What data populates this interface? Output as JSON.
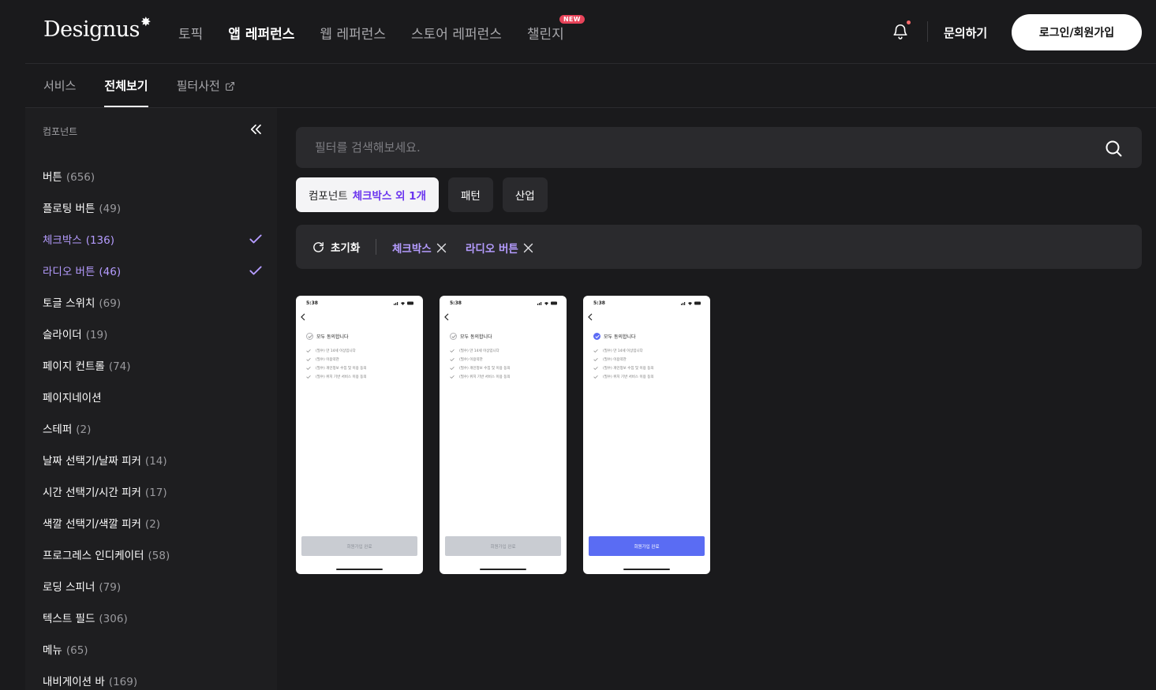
{
  "header": {
    "logo": "Designus",
    "nav": [
      {
        "label": "토픽",
        "active": false
      },
      {
        "label": "앱 레퍼런스",
        "active": true
      },
      {
        "label": "웹 레퍼런스",
        "active": false
      },
      {
        "label": "스토어 레퍼런스",
        "active": false
      },
      {
        "label": "챌린지",
        "active": false,
        "badge": "NEW"
      }
    ],
    "inquiry": "문의하기",
    "login": "로그인/회원가입",
    "notification_dot_color": "#ff6b6b"
  },
  "subtabs": [
    {
      "label": "서비스",
      "active": false
    },
    {
      "label": "전체보기",
      "active": true
    },
    {
      "label": "필터사전",
      "active": false,
      "external": true
    }
  ],
  "sidebar": {
    "title": "컴포넌트",
    "items": [
      {
        "label": "버튼",
        "count": "(656)",
        "checked": false
      },
      {
        "label": "플로팅 버튼",
        "count": "(49)",
        "checked": false
      },
      {
        "label": "체크박스",
        "count": "(136)",
        "checked": true
      },
      {
        "label": "라디오 버튼",
        "count": "(46)",
        "checked": true
      },
      {
        "label": "토글 스위치",
        "count": "(69)",
        "checked": false
      },
      {
        "label": "슬라이더",
        "count": "(19)",
        "checked": false
      },
      {
        "label": "페이지 컨트롤",
        "count": "(74)",
        "checked": false
      },
      {
        "label": "페이지네이션",
        "count": "",
        "checked": false
      },
      {
        "label": "스테퍼",
        "count": "(2)",
        "checked": false
      },
      {
        "label": "날짜 선택기/날짜 피커",
        "count": "(14)",
        "checked": false
      },
      {
        "label": "시간 선택기/시간 피커",
        "count": "(17)",
        "checked": false
      },
      {
        "label": "색깔 선택기/색깔 피커",
        "count": "(2)",
        "checked": false
      },
      {
        "label": "프로그레스 인디케이터",
        "count": "(58)",
        "checked": false
      },
      {
        "label": "로딩 스피너",
        "count": "(79)",
        "checked": false
      },
      {
        "label": "텍스트 필드",
        "count": "(306)",
        "checked": false
      },
      {
        "label": "메뉴",
        "count": "(65)",
        "checked": false
      },
      {
        "label": "내비게이션 바",
        "count": "(169)",
        "checked": false
      }
    ]
  },
  "search": {
    "placeholder": "필터를 검색해보세요."
  },
  "chips": {
    "component_label": "컴포넌트",
    "component_selected": "체크박스 외 1개",
    "pattern": "패턴",
    "industry": "산업"
  },
  "active_filters": {
    "reset": "초기화",
    "tags": [
      "체크박스",
      "라디오 버튼"
    ]
  },
  "accent_color": "#b59cff",
  "cards": [
    {
      "time": "5:38",
      "all_agree": "모두 동의합니다",
      "all_checked": false,
      "rows": [
        "(필수) 만 14세 이상입니다",
        "(필수) 이용약관",
        "(필수) 개인정보 수집 및 이용 동의",
        "(필수) 위치 기반 서비스 이용 동의"
      ],
      "cta": "회원가입 완료",
      "cta_enabled": false
    },
    {
      "time": "5:38",
      "all_agree": "모두 동의합니다",
      "all_checked": false,
      "rows": [
        "(필수) 만 14세 이상입니다",
        "(필수) 이용약관",
        "(필수) 개인정보 수집 및 이용 동의",
        "(필수) 위치 기반 서비스 이용 동의"
      ],
      "cta": "회원가입 완료",
      "cta_enabled": false
    },
    {
      "time": "5:38",
      "all_agree": "모두 동의합니다",
      "all_checked": true,
      "rows": [
        "(필수) 만 14세 이상입니다",
        "(필수) 이용약관",
        "(필수) 개인정보 수집 및 이용 동의",
        "(필수) 위치 기반 서비스 이용 동의"
      ],
      "cta": "회원가입 완료",
      "cta_enabled": true
    }
  ]
}
